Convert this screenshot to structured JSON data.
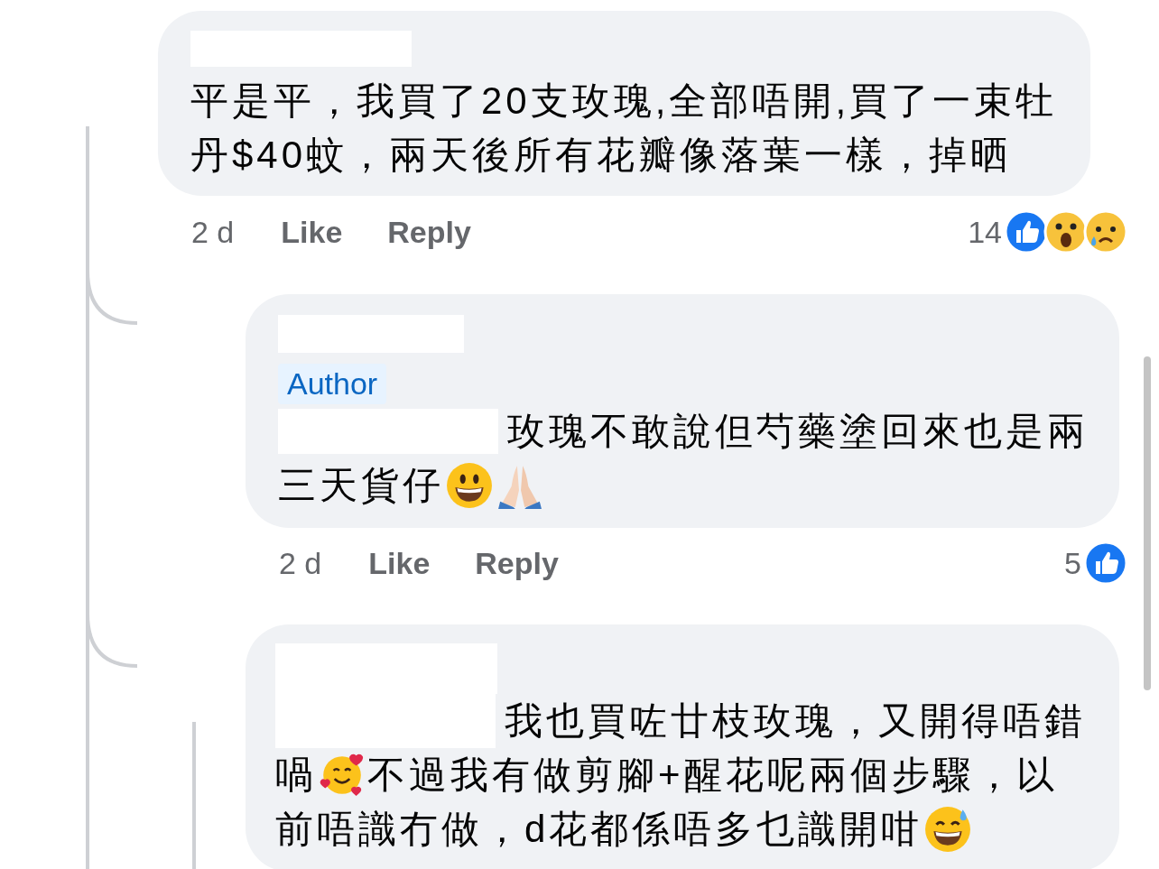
{
  "comments": [
    {
      "name": {
        "kind": "redacted"
      },
      "lines": [
        [
          {
            "kind": "text",
            "text": "平是平，我買了20支玫瑰,全部唔開,買了一束牡"
          }
        ],
        [
          {
            "kind": "text",
            "text": "丹$40蚊，兩天後所有花瓣像落葉一樣，掉晒"
          }
        ]
      ],
      "time": "2 d",
      "actions": [
        "Like",
        "Reply"
      ],
      "reaction_count": "14",
      "reactions": [
        {
          "kind": "like"
        },
        {
          "kind": "wow"
        },
        {
          "kind": "sad"
        }
      ],
      "replies": [
        {
          "name": {
            "kind": "redacted"
          },
          "badge": "Author",
          "lines": [
            [
              {
                "kind": "redacted"
              },
              {
                "kind": "text",
                "text": "玫瑰不敢說但芍藥塗回來也是兩"
              }
            ],
            [
              {
                "kind": "text",
                "text": "三天貨仔"
              },
              {
                "kind": "grin"
              },
              {
                "kind": "pray"
              }
            ]
          ],
          "time": "2 d",
          "actions": [
            "Like",
            "Reply"
          ],
          "reaction_count": "5",
          "reactions": [
            {
              "kind": "like"
            }
          ]
        },
        {
          "name": {
            "kind": "redacted"
          },
          "lines": [
            [
              {
                "kind": "redacted"
              },
              {
                "kind": "text",
                "text": "我也買咗廿枝玫瑰，又開得唔錯"
              }
            ],
            [
              {
                "kind": "text",
                "text": "喎"
              },
              {
                "kind": "hearts"
              },
              {
                "kind": "text",
                "text": "不過我有做剪腳+醒花呢兩個步驟，以"
              }
            ],
            [
              {
                "kind": "text",
                "text": "前唔識冇做，d花都係唔多乜識開咁"
              },
              {
                "kind": "sweat"
              }
            ]
          ]
        }
      ]
    }
  ]
}
